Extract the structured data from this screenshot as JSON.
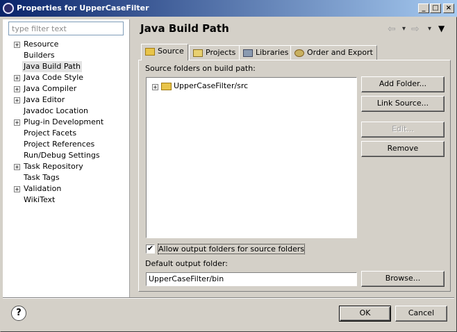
{
  "window": {
    "title": "Properties for UpperCaseFilter"
  },
  "filter": {
    "placeholder": "type filter text"
  },
  "tree": {
    "items": [
      {
        "label": "Resource",
        "expandable": true
      },
      {
        "label": "Builders",
        "expandable": false
      },
      {
        "label": "Java Build Path",
        "expandable": false,
        "selected": true
      },
      {
        "label": "Java Code Style",
        "expandable": true
      },
      {
        "label": "Java Compiler",
        "expandable": true
      },
      {
        "label": "Java Editor",
        "expandable": true
      },
      {
        "label": "Javadoc Location",
        "expandable": false
      },
      {
        "label": "Plug-in Development",
        "expandable": true
      },
      {
        "label": "Project Facets",
        "expandable": false
      },
      {
        "label": "Project References",
        "expandable": false
      },
      {
        "label": "Run/Debug Settings",
        "expandable": false
      },
      {
        "label": "Task Repository",
        "expandable": true
      },
      {
        "label": "Task Tags",
        "expandable": false
      },
      {
        "label": "Validation",
        "expandable": true
      },
      {
        "label": "WikiText",
        "expandable": false
      }
    ]
  },
  "page": {
    "title": "Java Build Path"
  },
  "tabs": [
    {
      "label": "Source",
      "active": true
    },
    {
      "label": "Projects",
      "active": false
    },
    {
      "label": "Libraries",
      "active": false
    },
    {
      "label": "Order and Export",
      "active": false
    }
  ],
  "source": {
    "folders_label": "Source folders on build path:",
    "folders": [
      "UpperCaseFilter/src"
    ],
    "buttons": {
      "add_folder": "Add Folder...",
      "link_source": "Link Source...",
      "edit": "Edit...",
      "remove": "Remove"
    },
    "allow_output_label": "Allow output folders for source folders",
    "allow_output_checked": true,
    "default_output_label": "Default output folder:",
    "default_output_value": "UpperCaseFilter/bin",
    "browse": "Browse..."
  },
  "footer": {
    "ok": "OK",
    "cancel": "Cancel",
    "help": "?"
  },
  "colors": {
    "titlebar": "#0a246a",
    "dialog_bg": "#d4d0c8",
    "folder": "#e8c44a"
  }
}
